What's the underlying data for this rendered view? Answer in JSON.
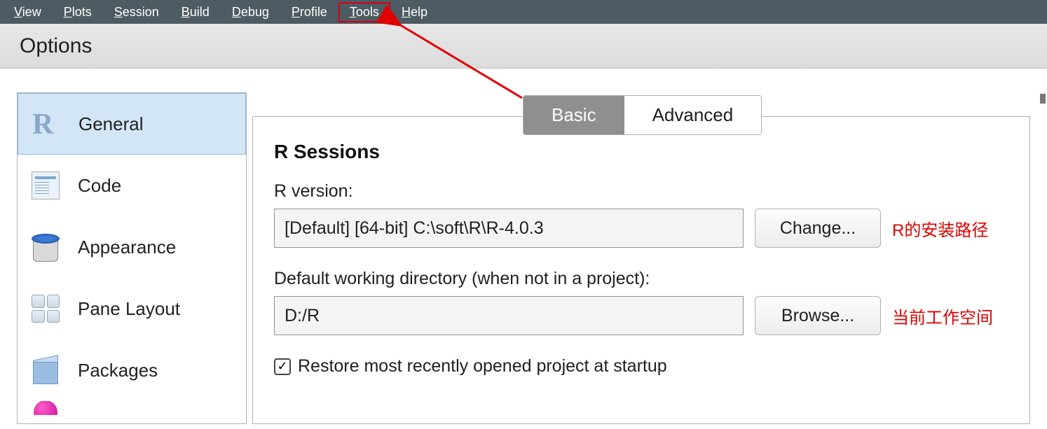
{
  "menubar": {
    "items": [
      {
        "pre": "",
        "ul": "V",
        "post": "iew"
      },
      {
        "pre": "",
        "ul": "P",
        "post": "lots"
      },
      {
        "pre": "",
        "ul": "S",
        "post": "ession"
      },
      {
        "pre": "",
        "ul": "B",
        "post": "uild"
      },
      {
        "pre": "",
        "ul": "D",
        "post": "ebug"
      },
      {
        "pre": "",
        "ul": "P",
        "post": "rofile"
      },
      {
        "pre": "",
        "ul": "T",
        "post": "ools"
      },
      {
        "pre": "",
        "ul": "H",
        "post": "elp"
      }
    ],
    "highlighted_index": 6
  },
  "dialog": {
    "title": "Options",
    "sidebar": {
      "items": [
        {
          "label": "General"
        },
        {
          "label": "Code"
        },
        {
          "label": "Appearance"
        },
        {
          "label": "Pane Layout"
        },
        {
          "label": "Packages"
        }
      ],
      "selected_index": 0
    },
    "tabs": {
      "items": [
        {
          "label": "Basic"
        },
        {
          "label": "Advanced"
        }
      ],
      "active_index": 0
    },
    "section_heading": "R Sessions",
    "r_version": {
      "label": "R version:",
      "value": "[Default] [64-bit] C:\\soft\\R\\R-4.0.3",
      "button": "Change...",
      "annotation": "R的安装路径"
    },
    "working_dir": {
      "label": "Default working directory (when not in a project):",
      "value": "D:/R",
      "button": "Browse...",
      "annotation": "当前工作空间"
    },
    "restore_checkbox": {
      "checked": true,
      "label": "Restore most recently opened project at startup"
    }
  }
}
